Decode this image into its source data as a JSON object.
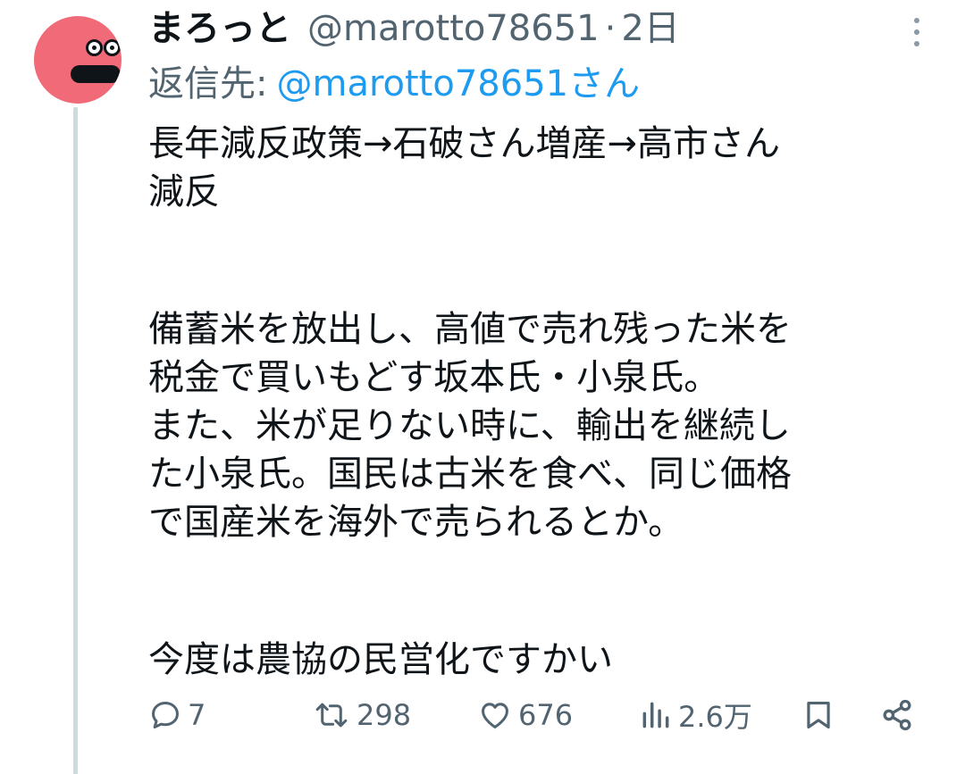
{
  "author": {
    "display_name": "まろっと",
    "handle": "@marotto78651",
    "separator": "·",
    "time": "2日"
  },
  "reply": {
    "prefix": "返信先:",
    "target": "@marotto78651さん"
  },
  "body_lines": [
    "長年減反政策→石破さん増産→高市さん",
    "減反",
    "備蓄米を放出し、高値で売れ残った米を",
    "税金で買いもどす坂本氏・小泉氏。",
    "また、米が足りない時に、輸出を継続し",
    "た小泉氏。国民は古米を食べ、同じ価格",
    "で国産米を海外で売られるとか。",
    "今度は農協の民営化ですかい"
  ],
  "actions": {
    "replies": "7",
    "retweets": "298",
    "likes": "676",
    "views": "2.6万"
  },
  "colors": {
    "text": "#0f1419",
    "muted": "#536471",
    "link": "#1d9bf0",
    "thread_line": "#cfd9de",
    "avatar_bg": "#f06a78"
  },
  "icons": [
    "avatar",
    "more-icon",
    "reply-icon",
    "retweet-icon",
    "like-icon",
    "views-icon",
    "bookmark-icon",
    "share-icon"
  ]
}
